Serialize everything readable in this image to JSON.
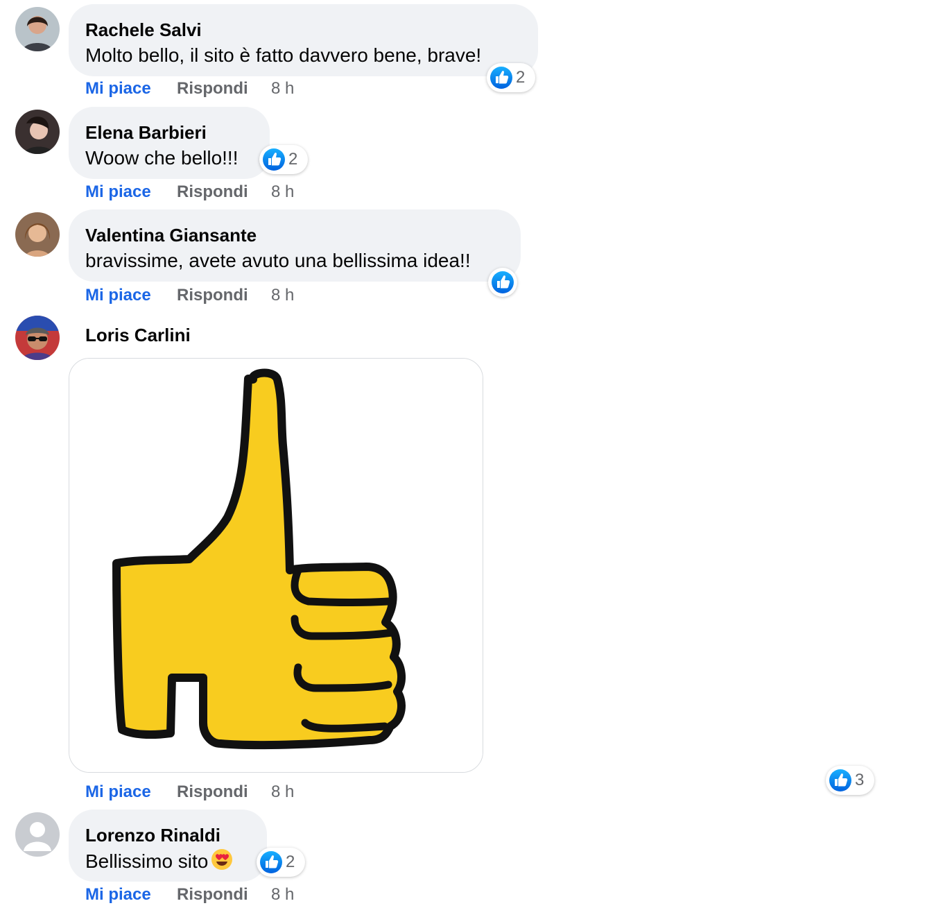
{
  "actions": {
    "like_label": "Mi piace",
    "reply_label": "Rispondi"
  },
  "comments": [
    {
      "author": "Rachele Salvi",
      "text": "Molto bello, il sito è fatto davvero bene, brave!",
      "time": "8 h",
      "reaction_count": "2"
    },
    {
      "author": "Elena Barbieri",
      "text": "Woow che bello!!!",
      "time": "8 h",
      "reaction_count": "2"
    },
    {
      "author": "Valentina Giansante",
      "text": "bravissime, avete avuto una bellissima idea!!",
      "time": "8 h",
      "reaction_count": ""
    },
    {
      "author": "Loris Carlini",
      "text": "",
      "time": "8 h",
      "reaction_count": "3",
      "attachment_icon": "thumbs-up-sticker"
    },
    {
      "author": "Lorenzo Rinaldi",
      "text": "Bellissimo sito",
      "emoji": "heart-eyes-emoji",
      "time": "8 h",
      "reaction_count": "2"
    }
  ],
  "colors": {
    "link_blue": "#1b66e6",
    "secondary_text": "#65676b",
    "bubble_bg": "#f0f2f5",
    "like_blue": "#1877f2"
  }
}
